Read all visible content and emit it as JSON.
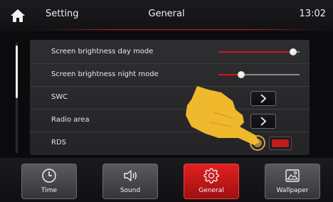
{
  "header": {
    "app_title": "Setting",
    "page_title": "General",
    "time": "13:02"
  },
  "settings": {
    "rows": [
      {
        "label": "Screen brightness day mode",
        "control": "slider",
        "level": 0.92
      },
      {
        "label": "Screen brightness night mode",
        "control": "slider",
        "level": 0.28
      },
      {
        "label": "SWC",
        "control": "arrow-button"
      },
      {
        "label": "Radio area",
        "control": "arrow-button"
      },
      {
        "label": "RDS",
        "control": "toggle",
        "state": "on"
      }
    ]
  },
  "bottom_nav": {
    "items": [
      {
        "label": "Time",
        "icon": "clock-icon",
        "active": false
      },
      {
        "label": "Sound",
        "icon": "speaker-icon",
        "active": false
      },
      {
        "label": "General",
        "icon": "gear-icon",
        "active": true
      },
      {
        "label": "Wallpaper",
        "icon": "picture-icon",
        "active": false
      }
    ]
  },
  "colors": {
    "accent": "#cc1e1e",
    "hand": "#f0b82c",
    "panel": "#2e2e31",
    "background": "#0b0b0d"
  }
}
